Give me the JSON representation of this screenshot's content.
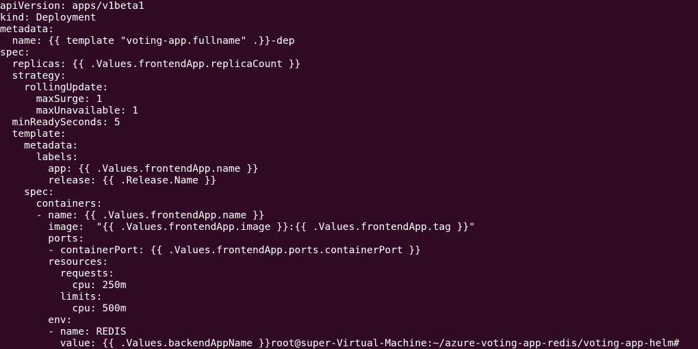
{
  "terminal": {
    "lines": [
      "apiVersion: apps/v1beta1",
      "kind: Deployment",
      "metadata:",
      "  name: {{ template \"voting-app.fullname\" .}}-dep",
      "spec:",
      "  replicas: {{ .Values.frontendApp.replicaCount }}",
      "  strategy:",
      "    rollingUpdate:",
      "      maxSurge: 1",
      "      maxUnavailable: 1",
      "  minReadySeconds: 5",
      "  template:",
      "    metadata:",
      "      labels:",
      "        app: {{ .Values.frontendApp.name }}",
      "        release: {{ .Release.Name }}",
      "    spec:",
      "      containers:",
      "      - name: {{ .Values.frontendApp.name }}",
      "        image:  \"{{ .Values.frontendApp.image }}:{{ .Values.frontendApp.tag }}\"",
      "        ports:",
      "        - containerPort: {{ .Values.frontendApp.ports.containerPort }}",
      "        resources:",
      "          requests:",
      "            cpu: 250m",
      "          limits:",
      "            cpu: 500m",
      "        env:",
      "        - name: REDIS",
      "          value: {{ .Values.backendAppName }}root@super-Virtual-Machine:~/azure-voting-app-redis/voting-app-helm#"
    ]
  },
  "colors": {
    "background": "#300a24",
    "text": "#ffffff"
  }
}
